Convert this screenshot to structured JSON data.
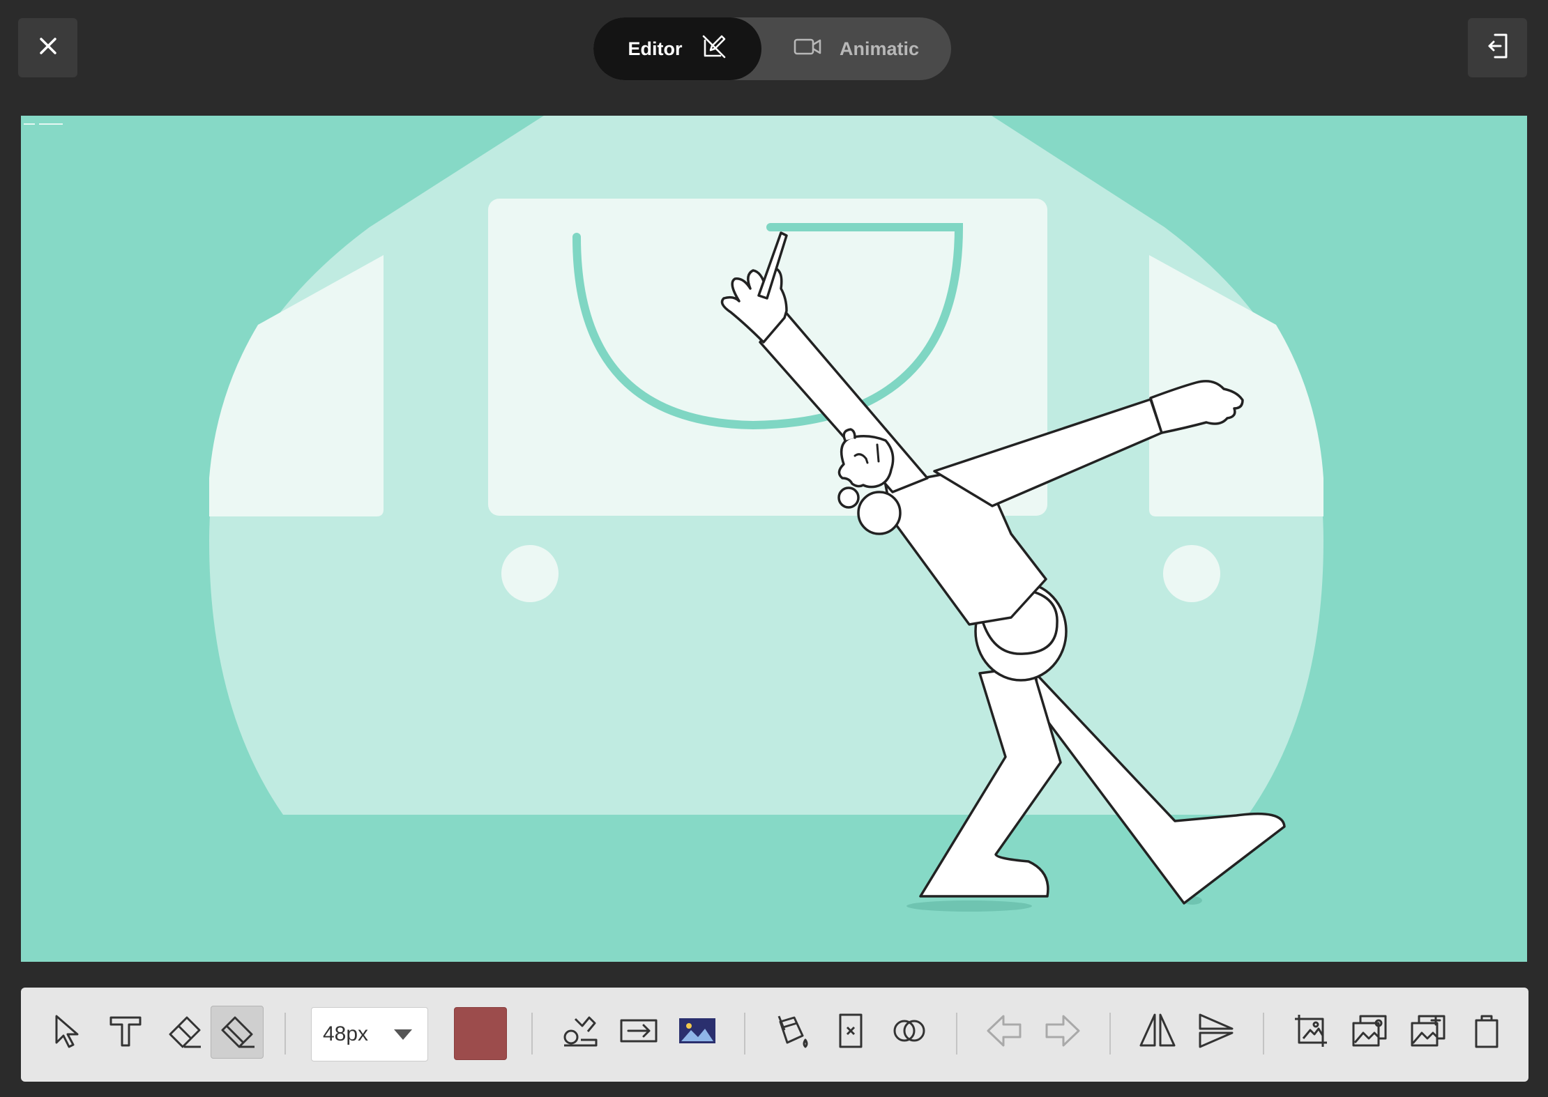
{
  "window": {
    "close_icon": "close-icon",
    "exit_icon": "exit-icon"
  },
  "mode_switch": {
    "tabs": [
      {
        "label": "Editor",
        "icon": "pencil-slash-icon",
        "active": true
      },
      {
        "label": "Animatic",
        "icon": "video-camera-icon",
        "active": false
      }
    ]
  },
  "canvas": {
    "background_color": "#86d9c6",
    "scene": "illustration of a figure drawing a teal semicircle on a window"
  },
  "toolbar": {
    "brush_size": "48px",
    "current_color": "#9c4c4c",
    "tools": [
      {
        "name": "select-tool",
        "icon": "cursor-icon"
      },
      {
        "name": "text-tool",
        "icon": "text-icon"
      },
      {
        "name": "eraser-tool",
        "icon": "eraser-icon"
      },
      {
        "name": "block-eraser-tool",
        "icon": "eraser-fill-icon",
        "selected": true
      },
      {
        "name": "shapes-tool",
        "icon": "shapes-icon"
      },
      {
        "name": "arrow-tool",
        "icon": "arrow-box-icon"
      },
      {
        "name": "image-tool",
        "icon": "image-icon"
      },
      {
        "name": "fill-tool",
        "icon": "paint-bucket-icon"
      },
      {
        "name": "clear-frame-tool",
        "icon": "clear-frame-icon"
      },
      {
        "name": "onion-skin-tool",
        "icon": "onion-skin-icon"
      },
      {
        "name": "undo-button",
        "icon": "arrow-left-icon",
        "disabled": true
      },
      {
        "name": "redo-button",
        "icon": "arrow-right-icon",
        "disabled": true
      },
      {
        "name": "flip-horizontal-button",
        "icon": "flip-horizontal-icon"
      },
      {
        "name": "flip-vertical-button",
        "icon": "flip-vertical-icon"
      },
      {
        "name": "import-image-button",
        "icon": "image-frame-icon"
      },
      {
        "name": "duplicate-frame-button",
        "icon": "image-stack-icon"
      },
      {
        "name": "add-frame-button",
        "icon": "image-add-icon"
      },
      {
        "name": "clipboard-button",
        "icon": "clipboard-icon"
      }
    ]
  }
}
